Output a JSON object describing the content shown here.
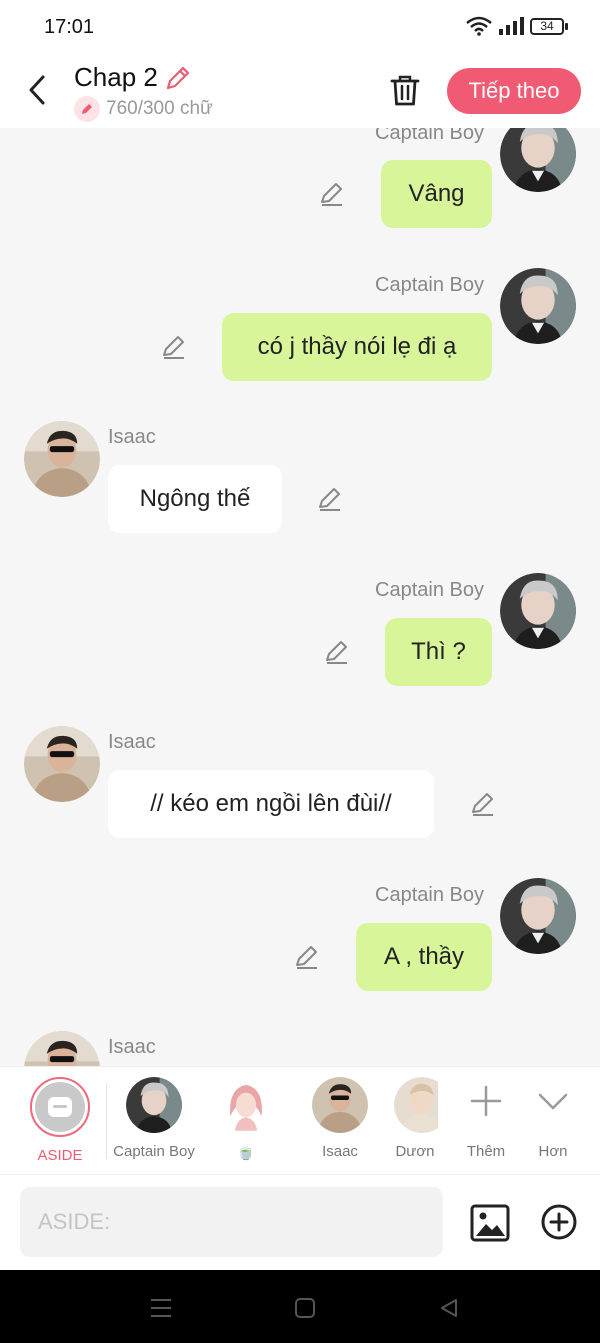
{
  "status": {
    "time": "17:01",
    "battery": "34"
  },
  "header": {
    "title": "Chap 2",
    "word_count": "760/300 chữ",
    "next_label": "Tiếp theo"
  },
  "messages": [
    {
      "side": "right",
      "name": "Captain Boy",
      "text": "Vâng"
    },
    {
      "side": "right",
      "name": "Captain Boy",
      "text": "có j thầy nói lẹ đi ạ"
    },
    {
      "side": "left",
      "name": "Isaac",
      "text": "Ngông thế"
    },
    {
      "side": "right",
      "name": "Captain Boy",
      "text": "Thì ?"
    },
    {
      "side": "left",
      "name": "Isaac",
      "text": "// kéo em ngồi lên đùi//"
    },
    {
      "side": "right",
      "name": "Captain Boy",
      "text": "A , thầy"
    },
    {
      "side": "left",
      "name": "Isaac",
      "text": ""
    }
  ],
  "characters": [
    {
      "label": "ASIDE",
      "selected": true
    },
    {
      "label": "Captain Boy"
    },
    {
      "label": "🍵"
    },
    {
      "label": "Isaac"
    },
    {
      "label": "Dươn"
    }
  ],
  "actions": {
    "more_label": "Thêm",
    "expand_label": "Hơn"
  },
  "input": {
    "placeholder": "ASIDE:"
  },
  "colors": {
    "accent": "#f05a72",
    "bubble_right": "#d8f59a",
    "bubble_left": "#ffffff",
    "background": "#f6f6f6"
  }
}
